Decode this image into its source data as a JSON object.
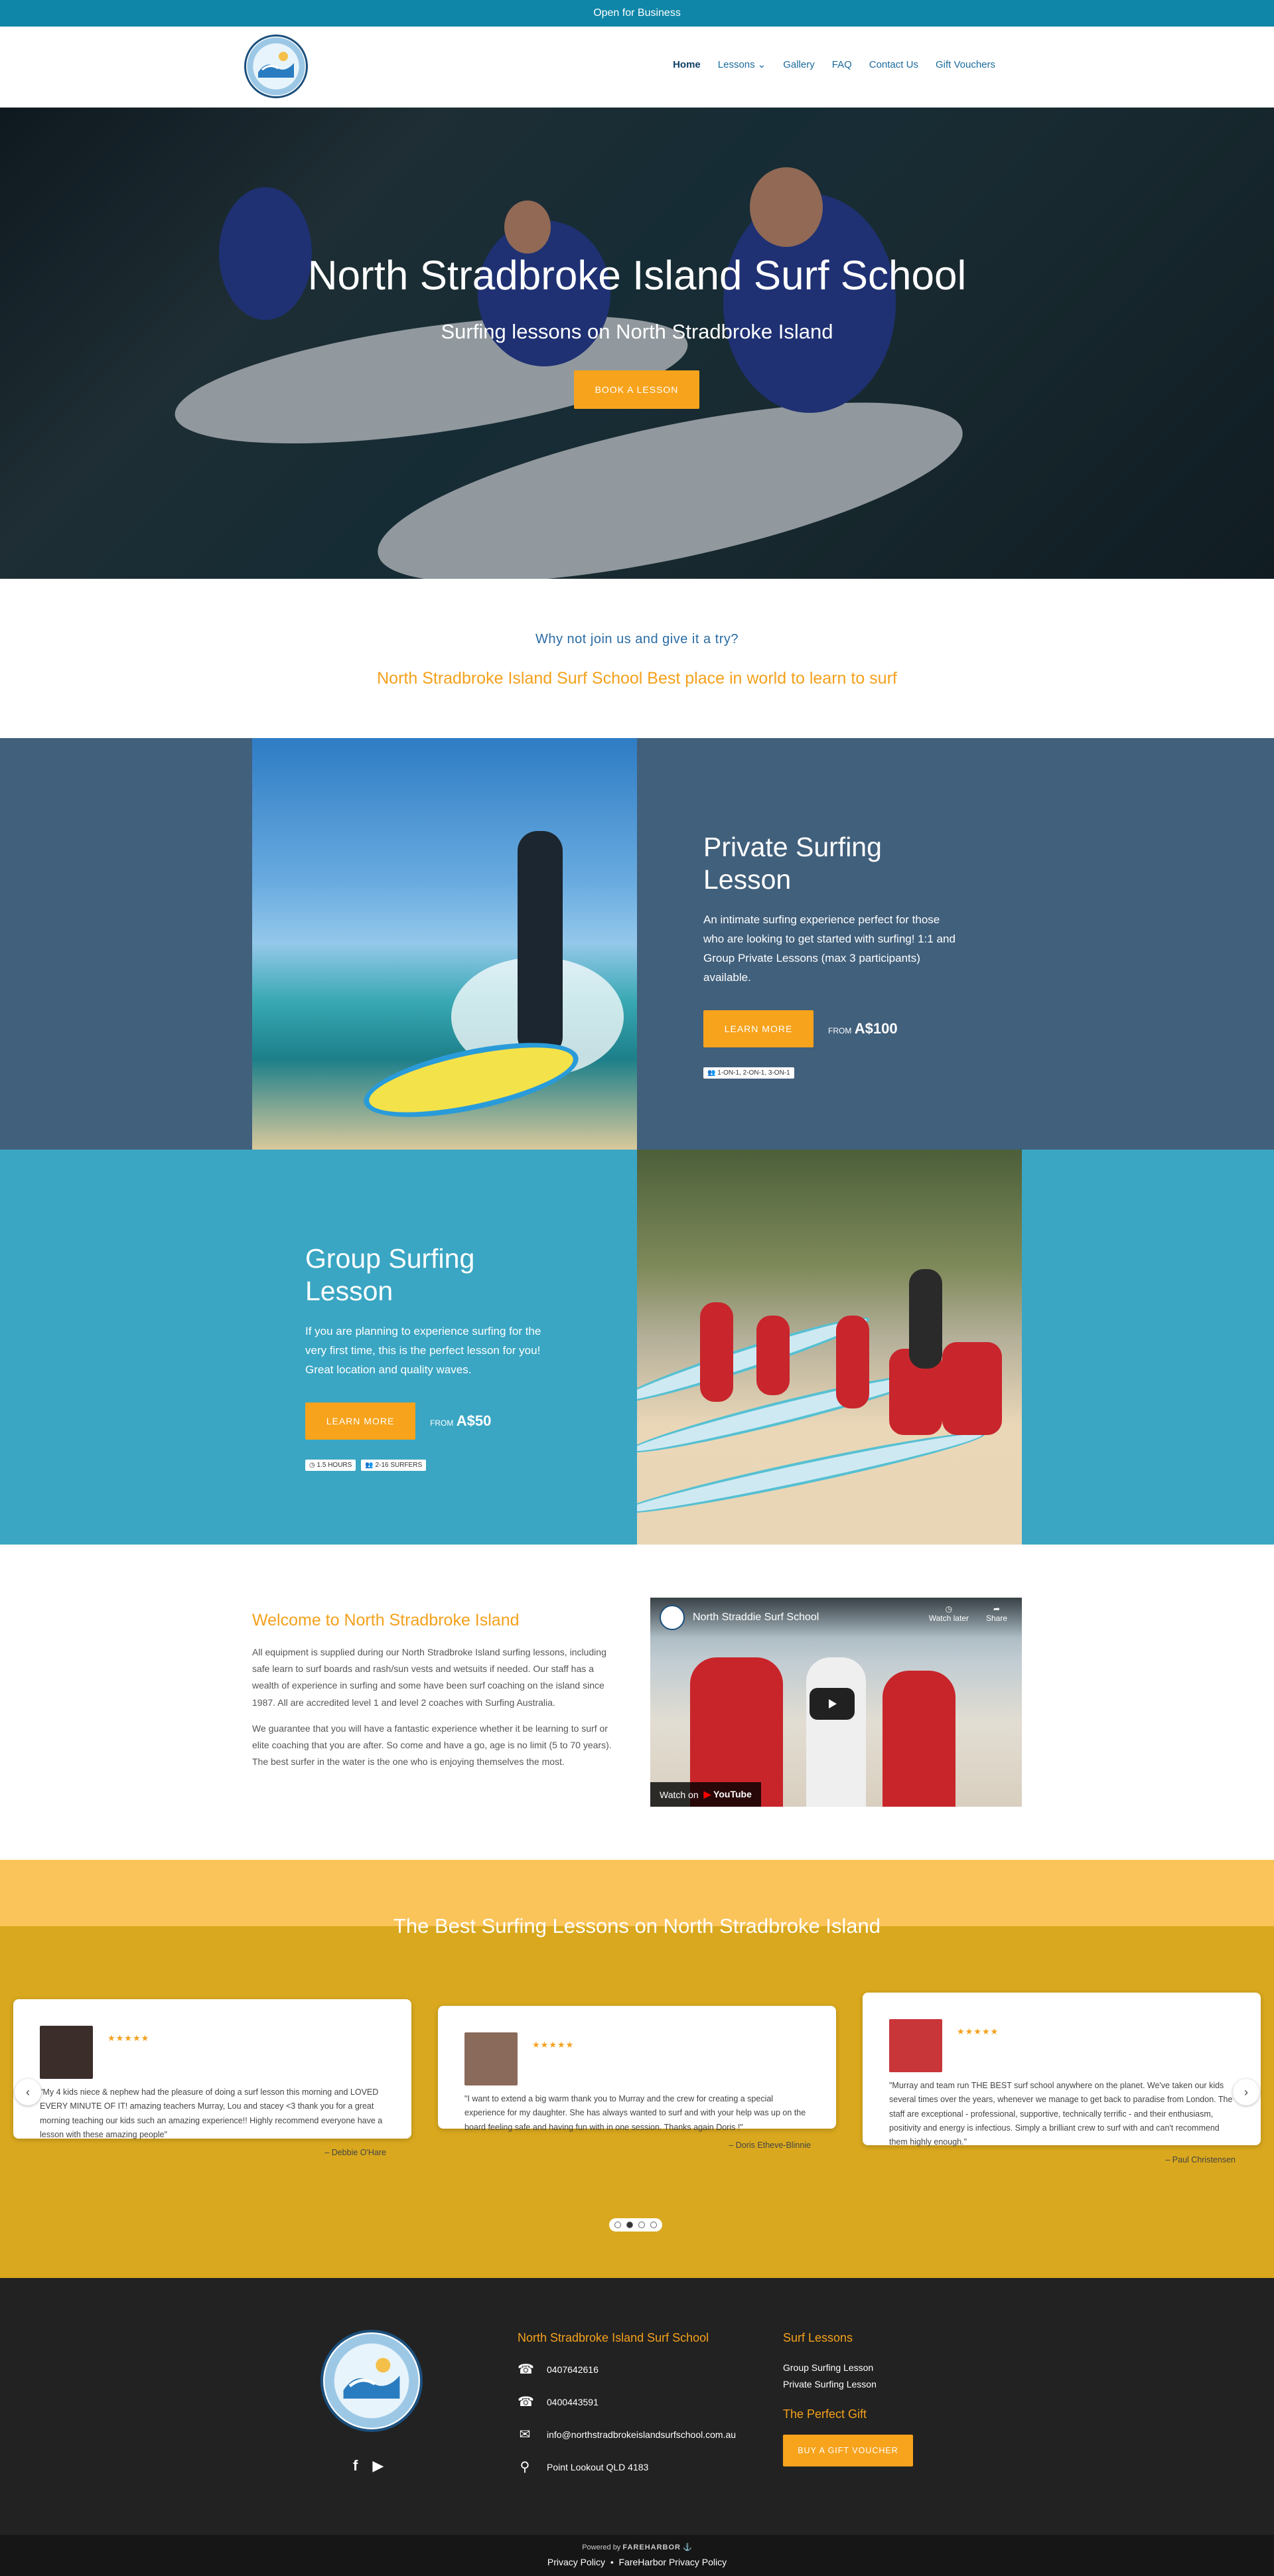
{
  "topbar": {
    "text": "Open for Business"
  },
  "nav": {
    "items": [
      {
        "label": "Home"
      },
      {
        "label": "Lessons"
      },
      {
        "label": "Gallery"
      },
      {
        "label": "FAQ"
      },
      {
        "label": "Contact Us"
      },
      {
        "label": "Gift Vouchers"
      }
    ]
  },
  "hero": {
    "title": "North Stradbroke Island Surf School",
    "subtitle": "Surfing lessons on North Stradbroke Island",
    "button": "BOOK A LESSON"
  },
  "intro": {
    "question": "Why not join us and give it a try?",
    "tagline": "North Stradbroke Island Surf School Best place in world to learn to surf"
  },
  "private": {
    "title": "Private Surfing Lesson",
    "description": "An intimate surfing experience perfect for those who are looking to get started with surfing! 1:1 and Group Private Lessons (max 3 participants) available.",
    "button": "LEARN MORE",
    "price_prefix": "FROM",
    "price": "A$100",
    "tag": "1-ON-1, 2-ON-1, 3-ON-1"
  },
  "group": {
    "title": "Group Surfing Lesson",
    "description": "If you are planning to experience surfing for the very first time, this is the perfect lesson for you! Great location and quality waves.",
    "button": "LEARN MORE",
    "price_prefix": "FROM",
    "price": "A$50",
    "tag_duration": "1.5 HOURS",
    "tag_size": "2-16 SURFERS"
  },
  "welcome": {
    "title": "Welcome to North Stradbroke Island",
    "para1": "All equipment is supplied during our North Stradbroke Island surfing lessons, including safe learn to surf boards and rash/sun vests and wetsuits if needed. Our staff has a wealth of experience in surfing and some have been surf coaching on the island since 1987. All are accredited level 1 and level 2 coaches with Surfing Australia.",
    "para2": "We guarantee that you will have a fantastic experience whether it be learning to surf or elite coaching that you are after. So come and have a go, age is no limit (5 to 70 years). The best surfer in the water is the one who is enjoying themselves the most."
  },
  "video": {
    "title": "North Straddie Surf School",
    "watch_later": "Watch later",
    "share": "Share",
    "watch_on": "Watch on",
    "platform": "YouTube"
  },
  "reviews": {
    "title": "The Best Surfing Lessons on North Stradbroke Island",
    "items": [
      {
        "stars": "★★★★★",
        "quote": "\"My 4 kids niece & nephew had the pleasure of doing a surf lesson this morning and LOVED EVERY MINUTE OF IT! amazing teachers Murray, Lou and stacey <3 thank you for a great morning teaching our kids such an amazing experience!! Highly recommend everyone have a lesson with these amazing people\"",
        "author": "– Debbie O'Hare"
      },
      {
        "stars": "★★★★★",
        "quote": "\"I want to extend a big warm thank you to Murray and the crew for creating a special experience for my daughter. She has always wanted to surf and with your help was up on the board feeling safe and having fun with in one session. Thanks again Doris !\"",
        "author": "– Doris Etheve-Blinnie"
      },
      {
        "stars": "★★★★★",
        "quote": "\"Murray and team run THE BEST surf school anywhere on the planet. We've taken our kids several times over the years, whenever we manage to get back to paradise from London. The staff are exceptional - professional, supportive, technically terrific - and their enthusiasm, positivity and energy is infectious. Simply a brilliant crew to surf with and can't recommend them highly enough.\"",
        "author": "– Paul Christensen"
      }
    ]
  },
  "footer": {
    "company": "North Stradbroke Island Surf School",
    "phone1": "0407642616",
    "phone2": "0400443591",
    "email": "info@northstradbrokeislandsurfschool.com.au",
    "address": "Point Lookout QLD 4183",
    "lessons_title": "Surf Lessons",
    "lesson1": "Group Surfing Lesson",
    "lesson2": "Private Surfing Lesson",
    "gift_title": "The Perfect Gift",
    "gift_button": "BUY A GIFT VOUCHER",
    "powered_by": "Powered by",
    "powered_brand": "FAREHARBOR",
    "privacy": "Privacy Policy",
    "separator": "•",
    "fh_privacy": "FareHarbor Privacy Policy"
  },
  "colors": {
    "topbar": "#0f86a8",
    "accent": "#f7a31c",
    "private_bg": "#41607c",
    "group_bg": "#3aa6c3",
    "footer": "#222222"
  },
  "icons": [
    "phone-icon",
    "envelope-icon",
    "map-pin-icon",
    "facebook-icon",
    "youtube-icon",
    "chevron-down-icon",
    "clock-icon",
    "people-icon"
  ]
}
